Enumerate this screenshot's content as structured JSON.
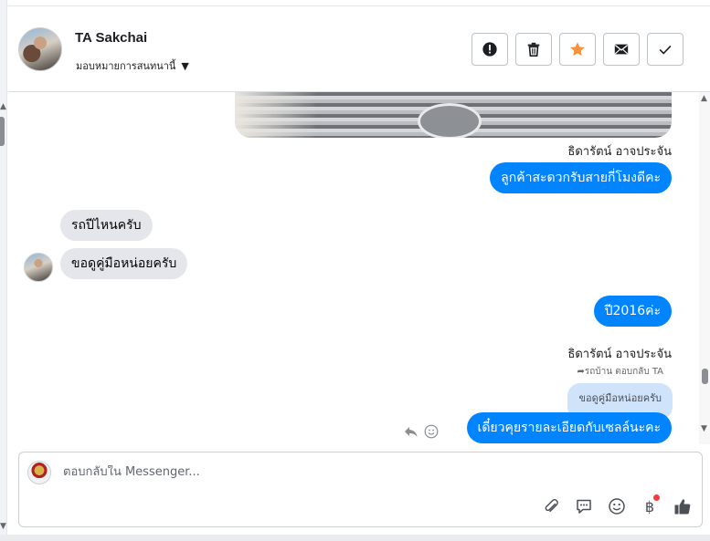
{
  "header": {
    "contact_name": "TA Sakchai",
    "assign_label": "มอบหมายการสนทนานี้",
    "actions": [
      {
        "icon": "alert-icon",
        "name": "mark-spam-button"
      },
      {
        "icon": "trash-icon",
        "name": "delete-button"
      },
      {
        "icon": "star-icon",
        "name": "star-button"
      },
      {
        "icon": "envelope-icon",
        "name": "mark-unread-button"
      },
      {
        "icon": "check-icon",
        "name": "mark-done-button"
      }
    ],
    "star_color": "#f7923b"
  },
  "conversation": {
    "sender_top": "ธิดารัตน์ อาจประจัน",
    "msg_out_1": "ลูกค้าสะดวกรับสายกี่โมงดีคะ",
    "msg_in_1": "รถปีไหนครับ",
    "msg_in_2": "ขอดูคู่มือหน่อยครับ",
    "msg_out_2": "ปี2016ค่ะ",
    "sender_bottom": "ธิดารัตน์ อาจประจัน",
    "reply_note": "รถบ้าน ตอบกลับ TA",
    "quoted_text": "ขอดูคู่มือหน่อยครับ",
    "msg_out_3": "เดี๋ยวคุยรายละเอียดกับเซลล์นะคะ"
  },
  "composer": {
    "placeholder": "ตอบกลับใน Messenger...",
    "tools": [
      "paperclip-icon",
      "speech-bubble-icon",
      "smiley-icon",
      "baht-icon",
      "thumbs-up-icon"
    ],
    "baht_symbol": "฿"
  },
  "colors": {
    "outgoing_bubble": "#0084ff",
    "incoming_bubble": "#e4e6eb",
    "quote_bubble": "#cfe3fb",
    "thumbs_up": "#4b4f56"
  }
}
